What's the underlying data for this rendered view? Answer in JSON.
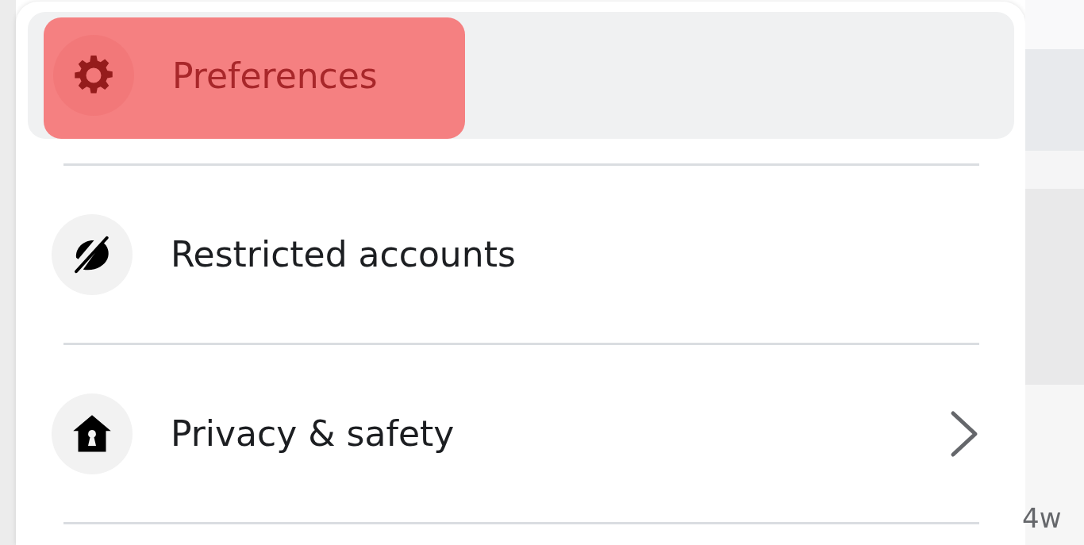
{
  "menu": {
    "items": [
      {
        "kind": "settings",
        "label": "Preferences",
        "selected": true,
        "highlighted": true,
        "submenu": false
      },
      {
        "kind": "restricted",
        "label": "Restricted accounts",
        "selected": false,
        "highlighted": false,
        "submenu": false
      },
      {
        "kind": "privacy",
        "label": "Privacy & safety",
        "selected": false,
        "highlighted": false,
        "submenu": true
      }
    ]
  },
  "background": {
    "timestamp": "4w"
  }
}
